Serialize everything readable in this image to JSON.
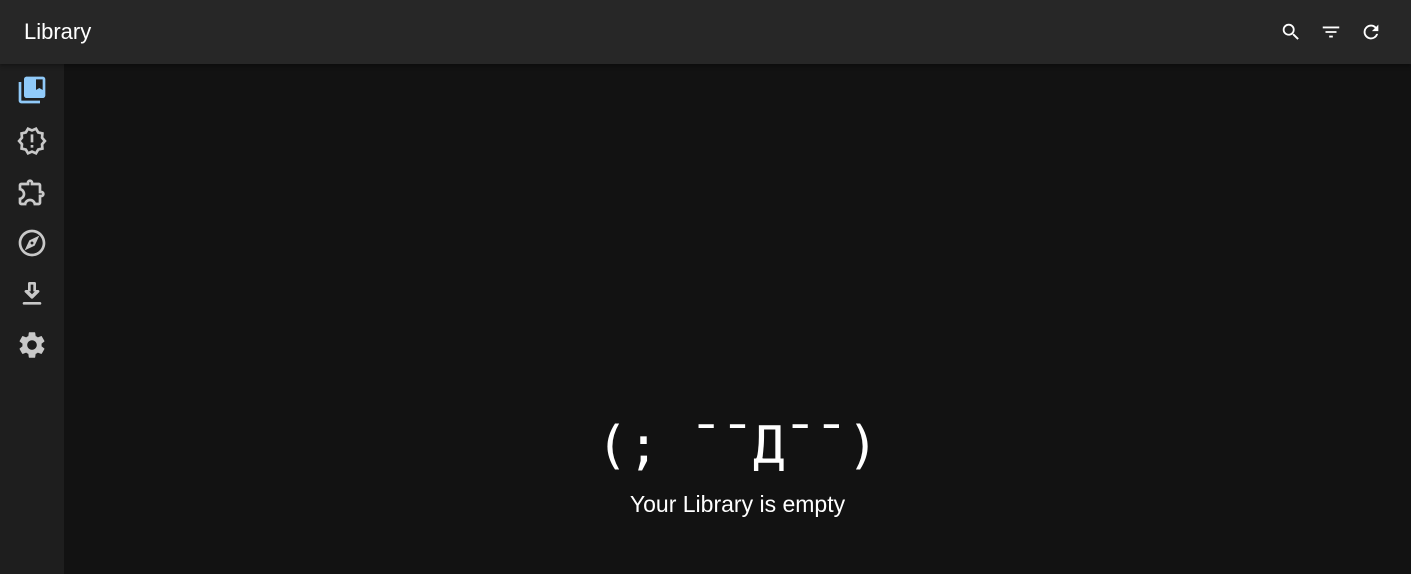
{
  "header": {
    "title": "Library",
    "actions": [
      {
        "icon": "search-icon"
      },
      {
        "icon": "filter-icon"
      },
      {
        "icon": "refresh-icon"
      }
    ]
  },
  "sidebar": {
    "items": [
      {
        "icon": "library-icon",
        "active": true
      },
      {
        "icon": "updates-alert-icon",
        "active": false
      },
      {
        "icon": "extensions-puzzle-icon",
        "active": false
      },
      {
        "icon": "explore-compass-icon",
        "active": false
      },
      {
        "icon": "download-icon",
        "active": false
      },
      {
        "icon": "settings-gear-icon",
        "active": false
      }
    ]
  },
  "empty_state": {
    "face": "(; ¯¯Д¯¯)",
    "message": "Your Library is empty"
  },
  "colors": {
    "topbar": "#272727",
    "sidebar": "#1e1e1e",
    "background": "#121212",
    "accent": "#90caf9",
    "icon": "#c8c8c8"
  }
}
